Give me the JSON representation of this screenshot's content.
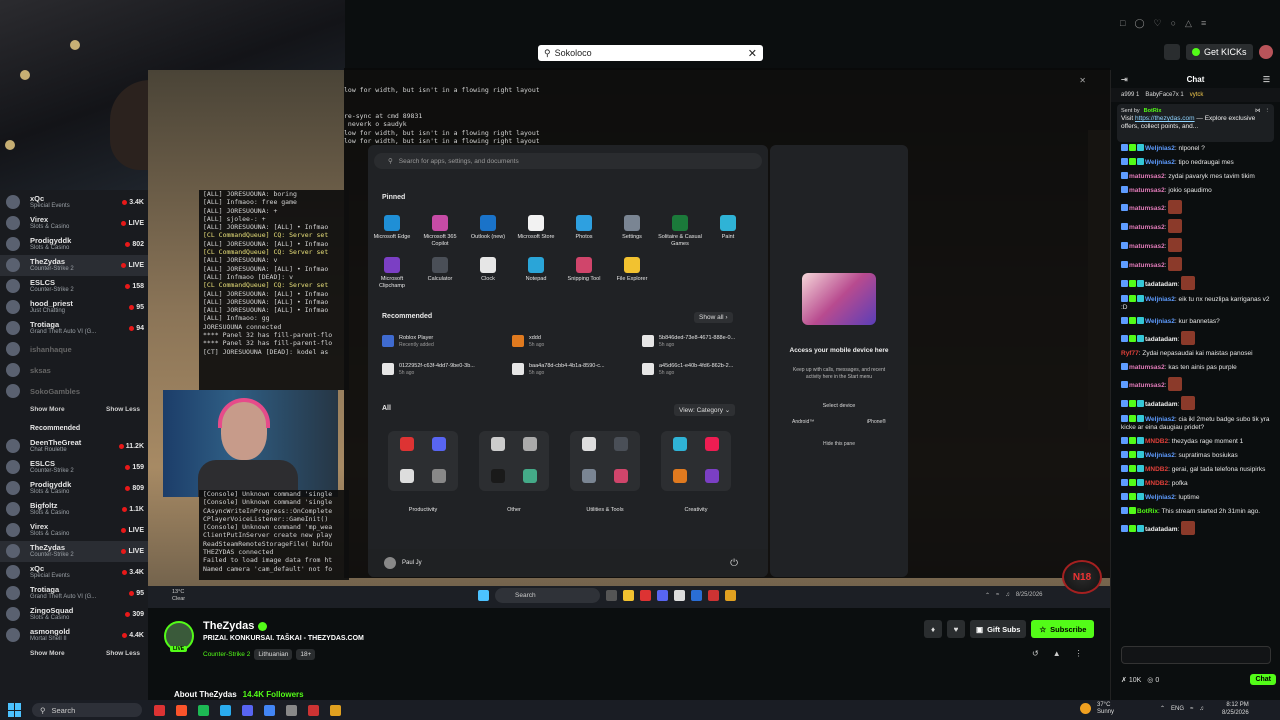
{
  "top_search": {
    "value": "Sokoloco"
  },
  "top_right": {
    "get_kicks": "Get KICKs"
  },
  "sidebar": {
    "following": [
      {
        "name": "xQc",
        "game": "Special Events",
        "viewers": "3.4K",
        "dim": false,
        "active": false
      },
      {
        "name": "Virex",
        "game": "Slots & Casino",
        "viewers": "LIVE",
        "dim": false,
        "active": false
      },
      {
        "name": "Prodigyddk",
        "game": "Slots & Casino",
        "viewers": "802",
        "dim": false,
        "active": false
      },
      {
        "name": "TheZydas",
        "game": "Counter-Strike 2",
        "viewers": "LIVE",
        "dim": false,
        "active": true
      },
      {
        "name": "ESLCS",
        "game": "Counter-Strike 2",
        "viewers": "158",
        "dim": false,
        "active": false
      },
      {
        "name": "hood_priest",
        "game": "Just Chatting",
        "viewers": "95",
        "dim": false,
        "active": false
      },
      {
        "name": "Trotiaga",
        "game": "Grand Theft Auto VI (G...",
        "viewers": "94",
        "dim": false,
        "active": false
      },
      {
        "name": "ishanhaque",
        "game": "",
        "viewers": "",
        "dim": true,
        "active": false
      },
      {
        "name": "sksas",
        "game": "",
        "viewers": "",
        "dim": true,
        "active": false
      },
      {
        "name": "SokoGambles",
        "game": "",
        "viewers": "",
        "dim": true,
        "active": false
      }
    ],
    "show_more": "Show More",
    "show_less": "Show Less",
    "recommended_header": "Recommended",
    "recommended": [
      {
        "name": "DeenTheGreat",
        "game": "Chat Roulette",
        "viewers": "11.2K",
        "active": false
      },
      {
        "name": "ESLCS",
        "game": "Counter-Strike 2",
        "viewers": "159",
        "active": false
      },
      {
        "name": "Prodigyddk",
        "game": "Slots & Casino",
        "viewers": "809",
        "active": false
      },
      {
        "name": "Bigfoltz",
        "game": "Slots & Casino",
        "viewers": "1.1K",
        "active": false
      },
      {
        "name": "Virex",
        "game": "Slots & Casino",
        "viewers": "LIVE",
        "active": false
      },
      {
        "name": "TheZydas",
        "game": "Counter-Strike 2",
        "viewers": "LIVE",
        "active": true
      },
      {
        "name": "xQc",
        "game": "Special Events",
        "viewers": "3.4K",
        "active": false
      },
      {
        "name": "Trotiaga",
        "game": "Grand Theft Auto VI (G...",
        "viewers": "95",
        "active": false
      },
      {
        "name": "ZingoSquad",
        "game": "Slots & Casino",
        "viewers": "309",
        "active": false
      },
      {
        "name": "asmongold",
        "game": "Mortal Shell II",
        "viewers": "4.4K",
        "active": false
      }
    ]
  },
  "terminal_lines": [
    "low for width, but isn't in a flowing right layout",
    "",
    "",
    "re-sync at cmd 89831",
    " neverk o saudyk",
    "low for width, but isn't in a flowing right layout",
    "low for width, but isn't in a flowing right layout"
  ],
  "console_left": [
    "[ALL] JORESUOUNA: boring",
    "[ALL] Infmaoo: free game",
    "[ALL] JORESUOUNA: +",
    "[ALL] sjolee-: +",
    "[ALL] JORESUOUNA: [ALL] • Infmao",
    "[CL CommandQueue] CQ: Server set",
    "[ALL] JORESUOUNA: [ALL] • Infmao",
    "[CL CommandQueue] CQ: Server set",
    "[ALL] JORESUOUNA: v",
    "[ALL] JORESUOUNA: [ALL] • Infmao",
    "[ALL] Infmaoo [DEAD]: v",
    "[CL CommandQueue] CQ: Server set",
    "[ALL] JORESUOUNA: [ALL] • Infmao",
    "[ALL] JORESUOUNA: [ALL] • Infmao",
    "[ALL] JORESUOUNA: [ALL] • Infmao",
    "[ALL] Infmaoo: gg",
    "JORESUOUNA connected",
    "**** Panel 32 has fill-parent-flo",
    "**** Panel 32 has fill-parent-flo",
    "[CT] JORESUOUNA [DEAD]: kodel as"
  ],
  "console_left2": [
    "[Console] Unknown command 'single",
    "[Console] Unknown command 'single",
    "CAsyncWriteInProgress::OnComplete",
    "CPlayerVoiceListener::GameInit()",
    "[Console] Unknown command 'mp_wea",
    "ClientPutInServer create new play",
    "ReadSteamRemoteStorageFile( bufOu",
    "THEZYDAS connected",
    "Failed to load image data from ht",
    "Named camera 'cam_default' not fo"
  ],
  "start_menu": {
    "search_placeholder": "Search for apps, settings, and documents",
    "pinned_title": "Pinned",
    "pinned": [
      {
        "label": "Microsoft Edge",
        "icon": "edge-icon",
        "color": "#1f8fd6"
      },
      {
        "label": "Microsoft 365 Copilot",
        "icon": "copilot-icon",
        "color": "#c64ba5"
      },
      {
        "label": "Outlook (new)",
        "icon": "outlook-icon",
        "color": "#1a73c9"
      },
      {
        "label": "Microsoft Store",
        "icon": "store-icon",
        "color": "#f2f2f2"
      },
      {
        "label": "Photos",
        "icon": "photos-icon",
        "color": "#2ea0e0"
      },
      {
        "label": "Settings",
        "icon": "settings-icon",
        "color": "#7a8593"
      },
      {
        "label": "Solitaire & Casual Games",
        "icon": "solitaire-icon",
        "color": "#1b7a3a"
      },
      {
        "label": "Paint",
        "icon": "paint-icon",
        "color": "#2fb3d6"
      },
      {
        "label": "Microsoft Clipchamp",
        "icon": "clipchamp-icon",
        "color": "#7b3fc4"
      },
      {
        "label": "Calculator",
        "icon": "calculator-icon",
        "color": "#4a4f57"
      },
      {
        "label": "Clock",
        "icon": "clock-icon",
        "color": "#e6e6e6"
      },
      {
        "label": "Notepad",
        "icon": "notepad-icon",
        "color": "#2aa5d8"
      },
      {
        "label": "Snipping Tool",
        "icon": "snipping-tool-icon",
        "color": "#d0456b"
      },
      {
        "label": "File Explorer",
        "icon": "file-explorer-icon",
        "color": "#f2c230"
      }
    ],
    "recommended_title": "Recommended",
    "show_all": "Show all  ›",
    "recommended": [
      {
        "title": "Roblox Player",
        "sub": "Recently added",
        "color": "#3f6bd0"
      },
      {
        "title": "xddd",
        "sub": "5h ago",
        "color": "#e07a1f"
      },
      {
        "title": "5b846ded-73e8-4671-888e-0...",
        "sub": "5h ago",
        "color": "#e6e6e6"
      },
      {
        "title": "0122952f-c63f-4dd7-9be0-3b...",
        "sub": "5h ago",
        "color": "#e6e6e6"
      },
      {
        "title": "baa4a78d-cbb4-4b1a-8590-c...",
        "sub": "5h ago",
        "color": "#e6e6e6"
      },
      {
        "title": "a45d66c1-e40b-4fd6-862b-2...",
        "sub": "5h ago",
        "color": "#e6e6e6"
      }
    ],
    "all_title": "All",
    "view_label": "View: Category  ⌄",
    "folders": [
      "Productivity",
      "Other",
      "Utilities & Tools",
      "Creativity"
    ],
    "user_name": "Paul Jy"
  },
  "phone_panel": {
    "title": "Access your mobile device here",
    "desc": "Keep up with calls, messages, and recent activity here in the Start menu",
    "select": "Select device",
    "android": "Android™",
    "iphone": "iPhone®",
    "hide": "Hide this pane"
  },
  "game_taskbar": {
    "weather_temp": "13°C",
    "weather_desc": "Clear",
    "search": "Search",
    "date": "8/25/2026"
  },
  "logo_badge": "N18",
  "stream": {
    "name": "TheZydas",
    "title": "PRIZAI. KONKURSAI. TAŠKAI - THEZYDAS.COM",
    "category": "Counter-Strike 2",
    "tag1": "Lithuanian",
    "tag2": "18+",
    "live": "LIVE",
    "about": "About TheZydas",
    "followers": "14.4K Followers",
    "gift": "Gift Subs",
    "subscribe": "Subscribe"
  },
  "chat": {
    "title": "Chat",
    "top_users": [
      {
        "name": "a999",
        "count": "1"
      },
      {
        "name": "BabyFace7x",
        "count": "1"
      },
      {
        "name": "vytck",
        "count": ""
      }
    ],
    "pinned_by": "Sent by",
    "pinned_user": "BotRix",
    "pinned_pre": "Visit ",
    "pinned_link": "https://thezydas.com",
    "pinned_post": " — Explore exclusive offers, collect points, and...",
    "messages": [
      {
        "user": "Weljnias2",
        "color": "#5e9cff",
        "text": "nlponel ?",
        "badges": 3,
        "emote": false
      },
      {
        "user": "Weljnias2",
        "color": "#5e9cff",
        "text": "tipo nedraugai mes",
        "badges": 3,
        "emote": false
      },
      {
        "user": "matumsas2",
        "color": "#e07ab8",
        "text": "zydai pavaryk mes tavim tikim",
        "badges": 1,
        "emote": false
      },
      {
        "user": "matumsas2",
        "color": "#e07ab8",
        "text": "jokio spaudimo",
        "badges": 1,
        "emote": false
      },
      {
        "user": "matumsas2",
        "color": "#e07ab8",
        "text": "",
        "badges": 1,
        "emote": true
      },
      {
        "user": "matumsas2",
        "color": "#e07ab8",
        "text": "",
        "badges": 1,
        "emote": true
      },
      {
        "user": "matumsas2",
        "color": "#e07ab8",
        "text": "",
        "badges": 1,
        "emote": true
      },
      {
        "user": "matumsas2",
        "color": "#e07ab8",
        "text": "",
        "badges": 1,
        "emote": true
      },
      {
        "user": "tadatadam",
        "color": "#f0f0f0",
        "text": "",
        "badges": 3,
        "emote": true
      },
      {
        "user": "Weljnias2",
        "color": "#5e9cff",
        "text": "eik tu nx neuzlipa karriganas v2 :D",
        "badges": 3,
        "emote": false
      },
      {
        "user": "Weljnias2",
        "color": "#5e9cff",
        "text": "kur bannetas?",
        "badges": 3,
        "emote": false
      },
      {
        "user": "tadatadam",
        "color": "#f0f0f0",
        "text": "",
        "badges": 3,
        "emote": true
      },
      {
        "user": "Ryf77",
        "color": "#e0403a",
        "text": "Zydai nepasaudai kai maistas panosei",
        "badges": 0,
        "emote": false
      },
      {
        "user": "matumsas2",
        "color": "#e07ab8",
        "text": "kas ten ainis pas purple",
        "badges": 1,
        "emote": false
      },
      {
        "user": "matumsas2",
        "color": "#e07ab8",
        "text": "",
        "badges": 1,
        "emote": true
      },
      {
        "user": "tadatadam",
        "color": "#f0f0f0",
        "text": "",
        "badges": 3,
        "emote": true
      },
      {
        "user": "Weljnias2",
        "color": "#5e9cff",
        "text": "cia ikl 2metu badge subo tik yra kicke ar eina daugiau pridet?",
        "badges": 3,
        "emote": false
      },
      {
        "user": "MNDB2",
        "color": "#e0403a",
        "text": "thezydas rage moment 1",
        "badges": 3,
        "emote": false
      },
      {
        "user": "Weljnias2",
        "color": "#5e9cff",
        "text": "supratimas bosiukas",
        "badges": 3,
        "emote": false
      },
      {
        "user": "MNDB2",
        "color": "#e0403a",
        "text": "gerai, gal tada telefona nusipirks",
        "badges": 3,
        "emote": false
      },
      {
        "user": "MNDB2",
        "color": "#e0403a",
        "text": "pofka",
        "badges": 3,
        "emote": false
      },
      {
        "user": "Weljnias2",
        "color": "#5e9cff",
        "text": "luptime",
        "badges": 3,
        "emote": false
      },
      {
        "user": "BotRix",
        "color": "#53fc18",
        "text": "This stream started 2h 31min ago.",
        "badges": 2,
        "emote": false
      },
      {
        "user": "tadatadam",
        "color": "#f0f0f0",
        "text": "",
        "badges": 3,
        "emote": true
      }
    ],
    "kicks": "10K",
    "points": "0",
    "chat_button": "Chat"
  },
  "windows_taskbar": {
    "search": "Search",
    "weather_temp": "37°C",
    "weather_desc": "Sunny",
    "lang": "ENG",
    "time": "8:12 PM",
    "date": "8/25/2026"
  }
}
